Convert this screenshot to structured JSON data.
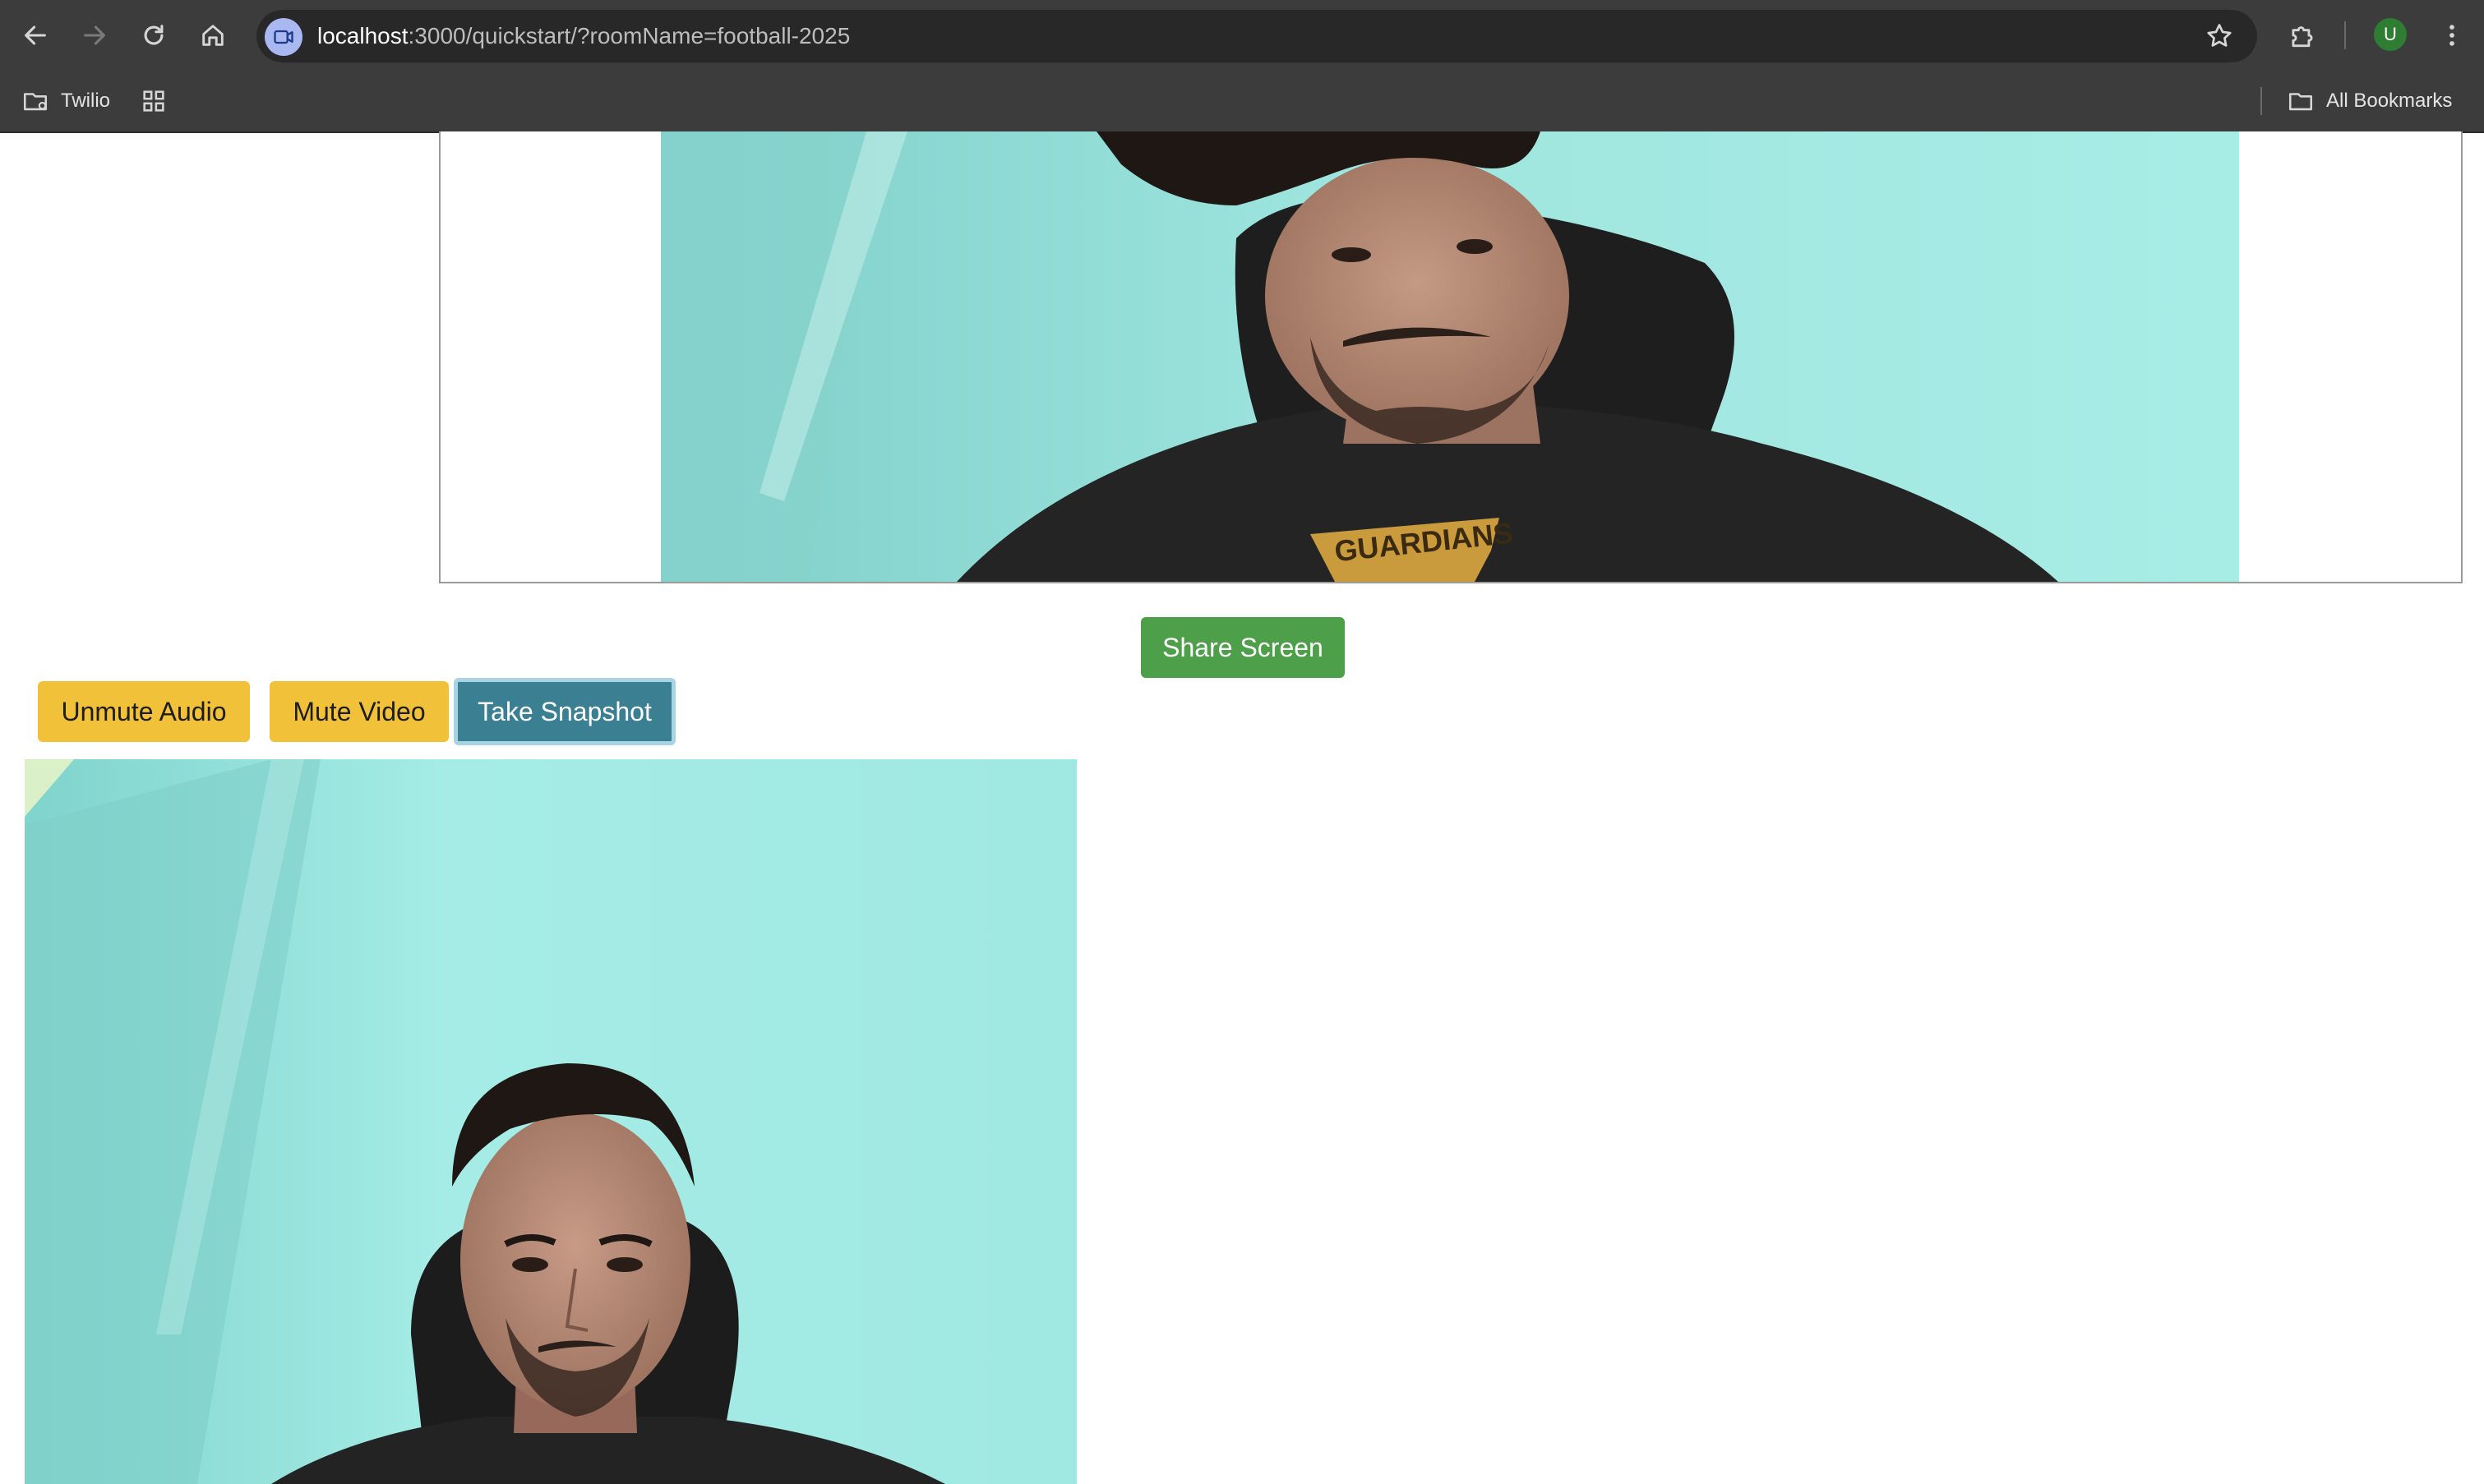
{
  "browser": {
    "url_host": "localhost",
    "url_rest": ":3000/quickstart/?roomName=football-2025",
    "profile_initial": "U",
    "bookmarks": [
      {
        "label": "Twilio",
        "icon": "bookmark-folder-icon"
      }
    ],
    "all_bookmarks_label": "All Bookmarks"
  },
  "controls": {
    "share_screen": "Share Screen",
    "unmute_audio": "Unmute Audio",
    "mute_video": "Mute Video",
    "take_snapshot": "Take Snapshot"
  },
  "colors": {
    "share_button": "#4e9f4a",
    "warning_button": "#f2c13a",
    "snapshot_button": "#3b7f93",
    "video_wall": "#9fe6df"
  },
  "videos": {
    "remote": {
      "icon": "remote-participant-video"
    },
    "local": {
      "icon": "local-participant-video"
    }
  }
}
